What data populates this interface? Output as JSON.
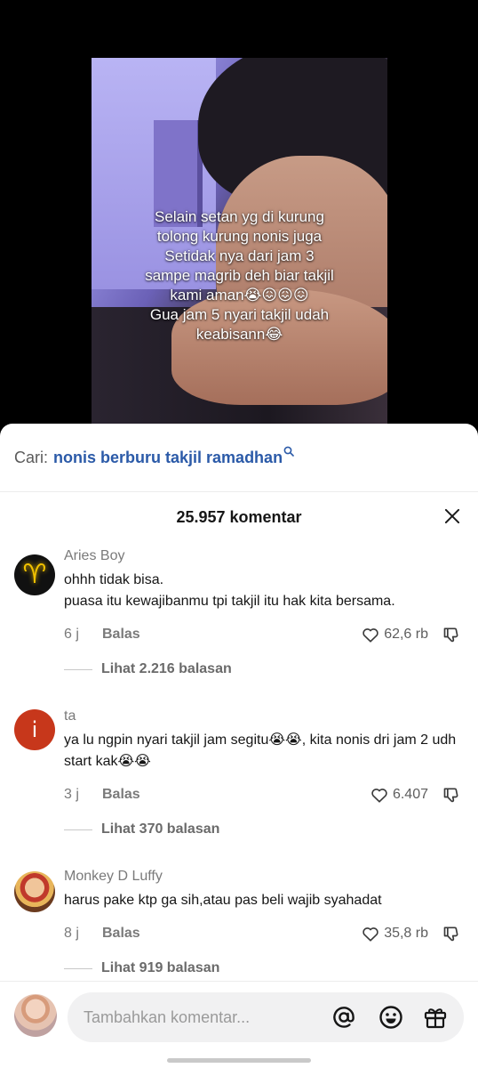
{
  "video": {
    "caption_lines": [
      "Selain setan yg di kurung",
      "tolong kurung nonis juga",
      "Setidak nya dari jam 3",
      "sampe magrib deh biar takjil",
      "kami aman😭😖😖😖",
      "Gua jam 5 nyari takjil udah",
      "keabisann😂"
    ]
  },
  "search": {
    "prefix": "Cari:",
    "query": "nonis berburu takjil ramadhan",
    "icon": "search-icon"
  },
  "comments_header": {
    "count_label": "25.957 komentar"
  },
  "comments": [
    {
      "user": "Aries Boy",
      "text_lines": [
        "ohhh tidak bisa.",
        "puasa itu kewajibanmu tpi takjil itu hak kita bersama."
      ],
      "time": "6 j",
      "reply_label": "Balas",
      "likes": "62,6 rb",
      "view_replies": "Lihat 2.216 balasan"
    },
    {
      "user": "ta",
      "avatar_letter": "i",
      "text_lines": [
        "ya lu ngpin nyari takjil jam segitu😭😭, kita nonis dri jam 2 udh",
        "start kak😭😭"
      ],
      "time": "3 j",
      "reply_label": "Balas",
      "likes": "6.407",
      "view_replies": "Lihat 370 balasan"
    },
    {
      "user": "Monkey D Luffy",
      "text_lines": [
        "harus pake ktp ga sih,atau pas beli wajib syahadat"
      ],
      "time": "8 j",
      "reply_label": "Balas",
      "likes": "35,8 rb",
      "view_replies": "Lihat 919 balasan"
    }
  ],
  "composer": {
    "placeholder": "Tambahkan komentar...",
    "value": "",
    "icons": [
      "at-mention-icon",
      "emoji-icon",
      "gift-icon"
    ]
  },
  "colors": {
    "link_blue": "#2b5aa8",
    "muted_gray": "#7a7a7a",
    "avatar_red": "#c7371b"
  }
}
